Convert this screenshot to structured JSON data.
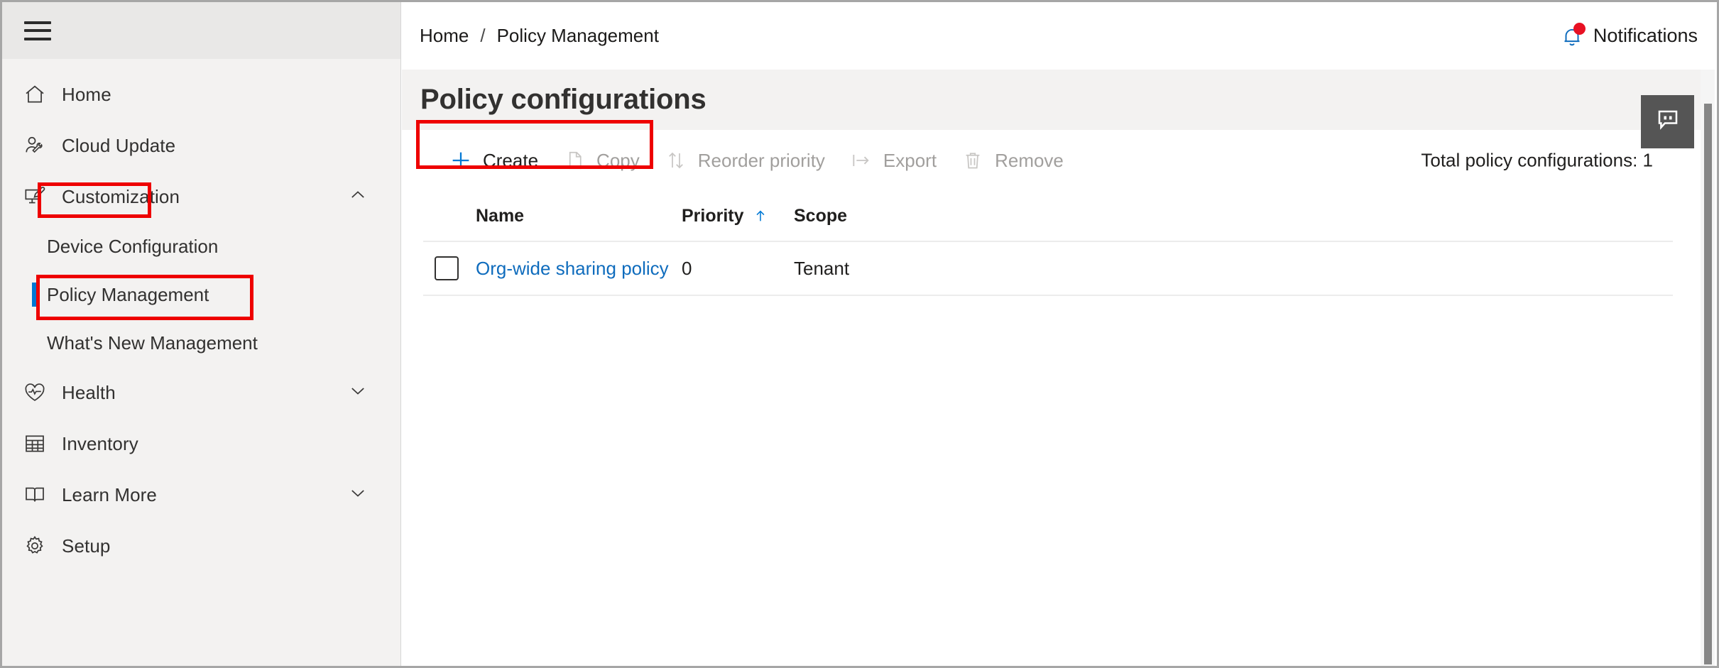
{
  "sidebar": {
    "menu_button": "menu-hamburger",
    "items": [
      {
        "label": "Home",
        "icon": "home-icon",
        "type": "item",
        "expandable": false
      },
      {
        "label": "Cloud Update",
        "icon": "person-wrench-icon",
        "type": "item",
        "expandable": false
      },
      {
        "label": "Customization",
        "icon": "screen-brush-icon",
        "type": "item",
        "expandable": true,
        "expanded": true,
        "chevron": "chevron-up-icon",
        "annotated": true
      },
      {
        "label": "Device Configuration",
        "type": "sub",
        "selected": false
      },
      {
        "label": "Policy Management",
        "type": "sub",
        "selected": true,
        "annotated": true
      },
      {
        "label": "What's New Management",
        "type": "sub",
        "selected": false
      },
      {
        "label": "Health",
        "icon": "heart-pulse-icon",
        "type": "item",
        "expandable": true,
        "expanded": false,
        "chevron": "chevron-down-icon"
      },
      {
        "label": "Inventory",
        "icon": "table-grid-icon",
        "type": "item",
        "expandable": false
      },
      {
        "label": "Learn More",
        "icon": "book-icon",
        "type": "item",
        "expandable": true,
        "expanded": false,
        "chevron": "chevron-down-icon"
      },
      {
        "label": "Setup",
        "icon": "gear-icon",
        "type": "item",
        "expandable": false
      }
    ]
  },
  "topbar": {
    "breadcrumb": {
      "home": "Home",
      "separator": "/",
      "current": "Policy Management"
    },
    "notifications": {
      "label": "Notifications",
      "icon": "bell-icon",
      "badge": true
    }
  },
  "main": {
    "page_title": "Policy configurations",
    "feedback_button": {
      "icon": "feedback-quote-icon"
    },
    "commands": [
      {
        "label": "Create",
        "icon": "plus-icon",
        "enabled": true
      },
      {
        "label": "Copy",
        "icon": "copy-icon",
        "enabled": false
      },
      {
        "label": "Reorder priority",
        "icon": "reorder-arrows-icon",
        "enabled": false
      },
      {
        "label": "Export",
        "icon": "export-arrow-icon",
        "enabled": false
      },
      {
        "label": "Remove",
        "icon": "trash-icon",
        "enabled": false
      }
    ],
    "total_count_text": "Total policy configurations: 1",
    "table": {
      "columns": [
        "Name",
        "Priority",
        "Scope"
      ],
      "sorted_column": "Priority",
      "sort_direction": "ascending",
      "sort_icon": "arrow-up-icon",
      "rows": [
        {
          "selected": false,
          "name": "Org-wide sharing policy",
          "priority": "0",
          "scope": "Tenant"
        }
      ]
    }
  },
  "colors": {
    "accent": "#0078d4",
    "link": "#0f6cbd",
    "annotation": "#ee0000",
    "badge": "#e81123",
    "sidebar_bg": "#f3f2f1",
    "feedback_bg": "#555555"
  }
}
